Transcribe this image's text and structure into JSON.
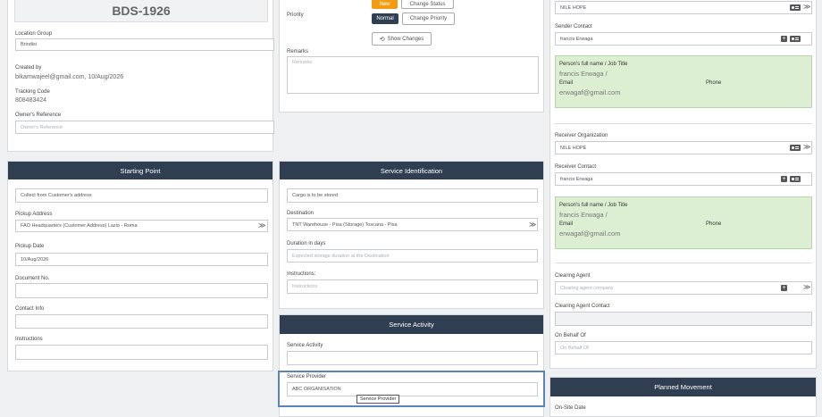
{
  "form": {
    "code": "BDS-1926",
    "location_group_label": "Location Group",
    "location_group": "Brindisi",
    "created_by_label": "Created by",
    "created_by": "bikamwajeel@gmail.com, 10/Aug/2026",
    "tracking_code_label": "Tracking Code",
    "tracking_code": "808483424",
    "owners_reference_label": "Owner's Reference",
    "owners_reference_placeholder": "Owner's Reference"
  },
  "status": {
    "status_value": "New",
    "change_status": "Change Status",
    "priority_label": "Priority",
    "priority_value": "Normal",
    "change_priority": "Change Priority",
    "show_changes": "Show Changes",
    "remarks_label": "Remarks",
    "remarks_placeholder": "Remarks"
  },
  "starting_point": {
    "title": "Starting Point",
    "mode": "Collect from Customer's address",
    "pickup_address_label": "Pickup Address",
    "pickup_address": "FAO Headquarters (Customer Address) Lazio - Roma",
    "pickup_date_label": "Pickup Date",
    "pickup_date": "10/Aug/2026",
    "document_no_label": "Document No.",
    "contact_info_label": "Contact Info",
    "instructions_label": "Instructions"
  },
  "service_identification": {
    "title": "Service Identification",
    "mode": "Cargo is to be stored",
    "destination_label": "Destination",
    "destination": "TNT Warehouse - Pisa (Storage) Toscana - Pisa",
    "duration_label": "Duration in days",
    "duration_placeholder": "Expected storage duration at the Destination",
    "instructions_label": "Instructions:",
    "instructions_placeholder": "Instructions"
  },
  "service_activity": {
    "title": "Service Activity",
    "activity_label": "Service Activity",
    "provider_label": "Service Provider",
    "provider_value": "ABC ORGANISATION",
    "tooltip": "Service Provider"
  },
  "parties": {
    "sender_org": "NILE HOPE",
    "sender_contact_label": "Sender Contact",
    "sender_contact": "francis Erwaga",
    "sender_card": {
      "name_label": "Person's full name / Job Title",
      "name": "francis Erwaga /",
      "email_label": "Email",
      "email": "erwagaf@gmail.com",
      "phone_label": "Phone"
    },
    "receiver_org_label": "Receiver Organization",
    "receiver_org": "NILE HOPE",
    "receiver_contact_label": "Receiver Contact",
    "receiver_contact": "francis Erwaga",
    "receiver_card": {
      "name_label": "Person's full name / Job Title",
      "name": "francis Erwaga /",
      "email_label": "Email",
      "email": "erwagaf@gmail.com",
      "phone_label": "Phone"
    },
    "clearing_agent_label": "Clearing Agent",
    "clearing_agent_placeholder": "Clearing agent company",
    "clearing_contact_label": "Clearing Agent Contact",
    "on_behalf_label": "On Behalf Of",
    "on_behalf_placeholder": "On Behalf Of"
  },
  "planned_movement": {
    "title": "Planned Movement",
    "onsite_date_label": "On-Site Date"
  },
  "colors": {
    "header": "#2f3f51",
    "status_new": "#f39c12",
    "priority_normal": "#2f3f51",
    "contact_card": "#dcefd3",
    "focus_outline": "#5b84b8"
  },
  "icons": [
    "id-card-icon",
    "chevron-down-icon",
    "plus-icon",
    "history-icon"
  ]
}
